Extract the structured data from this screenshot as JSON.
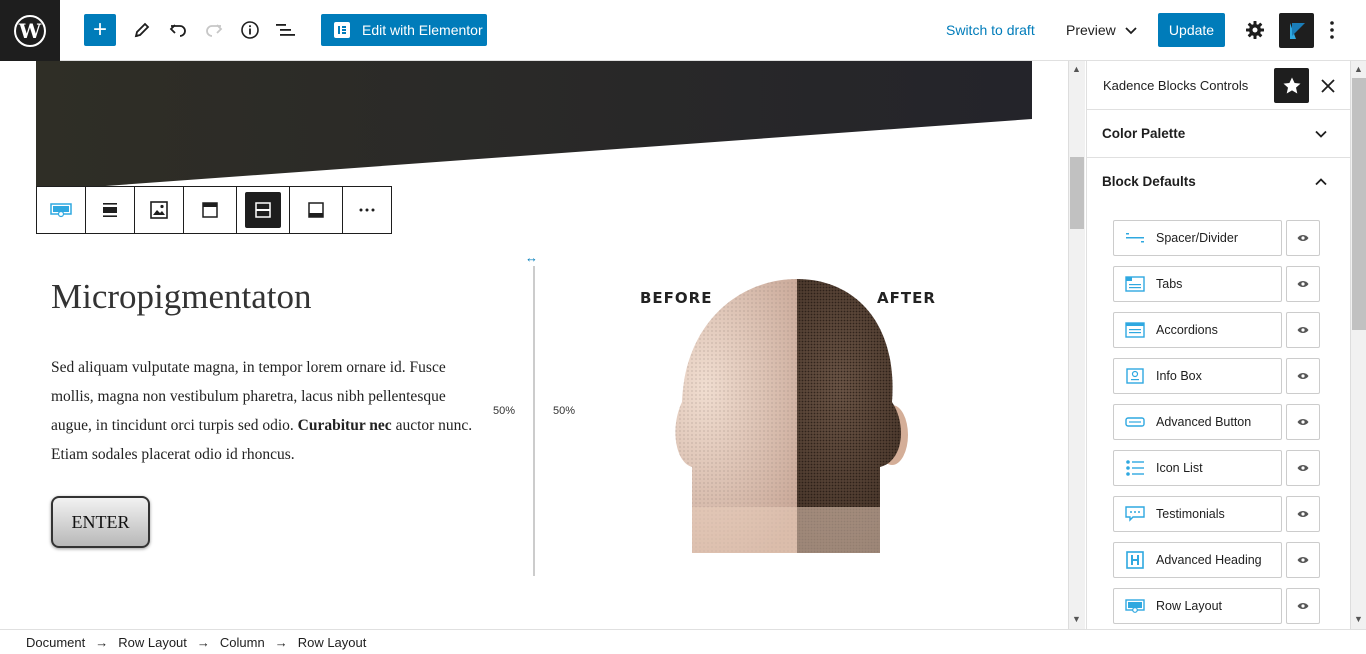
{
  "topbar": {
    "elementor_label": "Edit with Elementor",
    "switch_draft_label": "Switch to draft",
    "preview_label": "Preview",
    "update_label": "Update"
  },
  "content": {
    "heading": "Micropigmentaton",
    "paragraph_lines": [
      "Sed aliquam vulputate magna, in tempor lorem ornare id. Fusce",
      "mollis, magna non vestibulum pharetra, lacus nibh pellentesque",
      "augue, in tincidunt orci turpis sed odio.",
      "Curabitur nec",
      "auctor nunc.",
      "Etiam sodales placerat odio id rhoncus."
    ],
    "button_label": "ENTER",
    "left_col_width": "50%",
    "right_col_width": "50%",
    "image_before_label": "BEFORE",
    "image_after_label": "AFTER"
  },
  "sidebar": {
    "title": "Kadence Blocks Controls",
    "color_palette_label": "Color Palette",
    "block_defaults_label": "Block Defaults",
    "blocks": [
      {
        "label": "Spacer/Divider",
        "icon": "spacer-icon"
      },
      {
        "label": "Tabs",
        "icon": "tabs-icon"
      },
      {
        "label": "Accordions",
        "icon": "accordion-icon"
      },
      {
        "label": "Info Box",
        "icon": "info-box-icon"
      },
      {
        "label": "Advanced Button",
        "icon": "button-icon"
      },
      {
        "label": "Icon List",
        "icon": "icon-list-icon"
      },
      {
        "label": "Testimonials",
        "icon": "testimonials-icon"
      },
      {
        "label": "Advanced Heading",
        "icon": "heading-icon"
      },
      {
        "label": "Row Layout",
        "icon": "row-layout-icon"
      }
    ]
  },
  "breadcrumb": [
    "Document",
    "Row Layout",
    "Column",
    "Row Layout"
  ],
  "colors": {
    "accent": "#007cba",
    "dark": "#1e1e1e",
    "band": "#2f2e26"
  }
}
